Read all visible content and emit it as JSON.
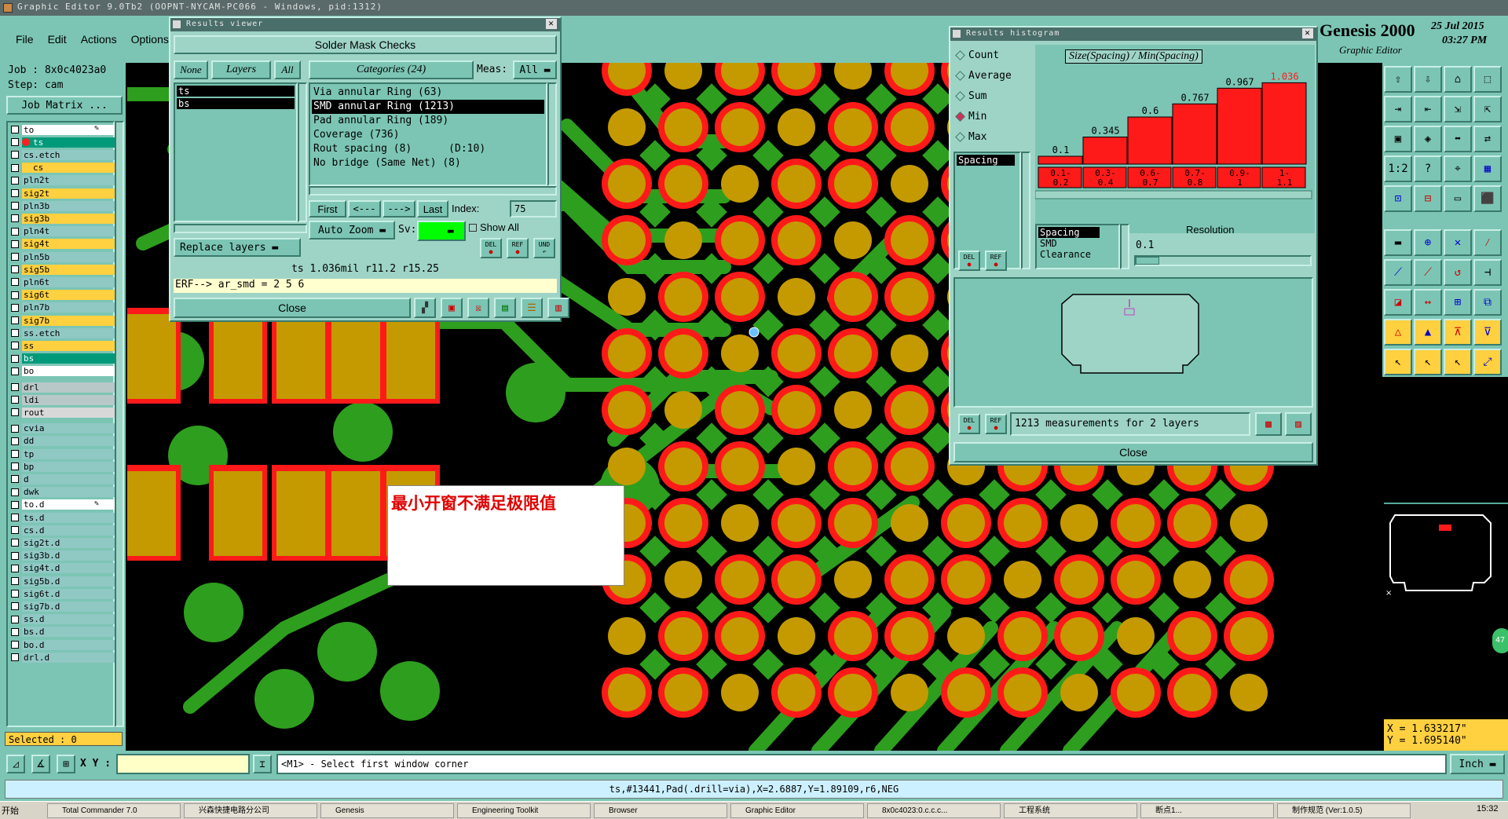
{
  "app": {
    "title_bar": "Graphic Editor 9.0Tb2 (OOPNT-NYCAM-PC066 - Windows, pid:1312)",
    "brand": "Genesis 2000",
    "brand_sub": "Graphic Editor",
    "date": "25 Jul 2015",
    "time": "03:27 PM"
  },
  "menu": [
    "File",
    "Edit",
    "Actions",
    "Options"
  ],
  "job": {
    "job": "Job : 8x0c4023a0",
    "step": "Step: cam",
    "matrix_button": "Job Matrix ..."
  },
  "layers": [
    {
      "name": "to",
      "color": "#ffffff",
      "text": "#000",
      "extra": "pen"
    },
    {
      "name": "ts",
      "color": "#009a7a",
      "text": "#fff",
      "dot": "#ff2020"
    },
    {
      "name": "cs.etch",
      "color": "#90c8c4",
      "text": "#000"
    },
    {
      "name": "cs",
      "color": "#ffd040",
      "text": "#000",
      "dot": "#ffd040"
    },
    {
      "name": "pln2t",
      "color": "#90c8c4",
      "text": "#000"
    },
    {
      "name": "sig2t",
      "color": "#ffd040",
      "text": "#000"
    },
    {
      "name": "pln3b",
      "color": "#90c8c4",
      "text": "#000"
    },
    {
      "name": "sig3b",
      "color": "#ffd040",
      "text": "#000"
    },
    {
      "name": "pln4t",
      "color": "#90c8c4",
      "text": "#000"
    },
    {
      "name": "sig4t",
      "color": "#ffd040",
      "text": "#000"
    },
    {
      "name": "pln5b",
      "color": "#90c8c4",
      "text": "#000"
    },
    {
      "name": "sig5b",
      "color": "#ffd040",
      "text": "#000"
    },
    {
      "name": "pln6t",
      "color": "#90c8c4",
      "text": "#000"
    },
    {
      "name": "sig6t",
      "color": "#ffd040",
      "text": "#000"
    },
    {
      "name": "pln7b",
      "color": "#90c8c4",
      "text": "#000"
    },
    {
      "name": "sig7b",
      "color": "#ffd040",
      "text": "#000"
    },
    {
      "name": "ss.etch",
      "color": "#90c8c4",
      "text": "#000"
    },
    {
      "name": "ss",
      "color": "#ffd040",
      "text": "#000"
    },
    {
      "name": "bs",
      "color": "#009a7a",
      "text": "#fff"
    },
    {
      "name": "bo",
      "color": "#ffffff",
      "text": "#000"
    },
    {
      "name": "drl",
      "color": "#b8c8c8",
      "text": "#000"
    },
    {
      "name": "ldi",
      "color": "#b8c8c8",
      "text": "#000"
    },
    {
      "name": "rout",
      "color": "#d8d8d8",
      "text": "#000"
    },
    {
      "name": "cvia",
      "color": "#90c8c4",
      "text": "#000"
    },
    {
      "name": "dd",
      "color": "#90c8c4",
      "text": "#000"
    },
    {
      "name": "tp",
      "color": "#90c8c4",
      "text": "#000"
    },
    {
      "name": "bp",
      "color": "#90c8c4",
      "text": "#000"
    },
    {
      "name": "d",
      "color": "#90c8c4",
      "text": "#000"
    },
    {
      "name": "dwk",
      "color": "#90c8c4",
      "text": "#000"
    },
    {
      "name": "to.d",
      "color": "#ffffff",
      "text": "#000",
      "extra": "pen"
    },
    {
      "name": "ts.d",
      "color": "#90c8c4",
      "text": "#000"
    },
    {
      "name": "cs.d",
      "color": "#90c8c4",
      "text": "#000"
    },
    {
      "name": "sig2t.d",
      "color": "#90c8c4",
      "text": "#000"
    },
    {
      "name": "sig3b.d",
      "color": "#90c8c4",
      "text": "#000"
    },
    {
      "name": "sig4t.d",
      "color": "#90c8c4",
      "text": "#000"
    },
    {
      "name": "sig5b.d",
      "color": "#90c8c4",
      "text": "#000"
    },
    {
      "name": "sig6t.d",
      "color": "#90c8c4",
      "text": "#000"
    },
    {
      "name": "sig7b.d",
      "color": "#90c8c4",
      "text": "#000"
    },
    {
      "name": "ss.d",
      "color": "#90c8c4",
      "text": "#000"
    },
    {
      "name": "bs.d",
      "color": "#90c8c4",
      "text": "#000"
    },
    {
      "name": "bo.d",
      "color": "#90c8c4",
      "text": "#000"
    },
    {
      "name": "drl.d",
      "color": "#90c8c4",
      "text": "#000"
    }
  ],
  "selected": "Selected : 0",
  "results_viewer": {
    "title": "Results viewer",
    "header": "Solder Mask Checks",
    "none": "None",
    "layers_label": "Layers",
    "all": "All",
    "layer_items": [
      "ts",
      "bs"
    ],
    "categories_label": "Categories (24)",
    "meas_label": "Meas:",
    "meas_value": "All",
    "categories": [
      {
        "text": "Via annular Ring (63)",
        "selected": false
      },
      {
        "text": "SMD annular Ring (1213)",
        "selected": true
      },
      {
        "text": "Pad annular Ring (189)",
        "selected": false
      },
      {
        "text": "Coverage (736)",
        "selected": false
      },
      {
        "text": "Rout spacing (8)      (D:10)",
        "selected": false
      },
      {
        "text": "No bridge (Same Net) (8)",
        "selected": false
      }
    ],
    "first": "First",
    "prev": "<---",
    "next": "--->",
    "last": "Last",
    "index_label": "Index:",
    "index_value": "75",
    "auto_zoom": "Auto Zoom",
    "sv_label": "Sv:",
    "show_all": "Show All",
    "replace_layers": "Replace layers",
    "del": "DEL",
    "ref": "REF",
    "und": "UND",
    "measurement": "ts 1.036mil   r11.2   r15.25",
    "erf": "ERF--> ar_smd = 2 5 6",
    "close": "Close"
  },
  "annotation": "最小开窗不满足极限值",
  "histogram": {
    "title": "Results histogram",
    "radio": [
      {
        "label": "Count",
        "checked": false
      },
      {
        "label": "Average",
        "checked": false
      },
      {
        "label": "Sum",
        "checked": false
      },
      {
        "label": "Min",
        "checked": true
      },
      {
        "label": "Max",
        "checked": false
      }
    ],
    "list_item": "Spacing",
    "chart_title": "Size(Spacing) / Min(Spacing)",
    "resolution_list": [
      "Spacing",
      "SMD",
      "Clearance"
    ],
    "resolution_label": "Resolution",
    "resolution_value": "0.1",
    "measurements": "1213 measurements for 2 layers",
    "close": "Close",
    "del": "DEL",
    "ref": "REF"
  },
  "chart_data": {
    "type": "bar",
    "title": "Size(Spacing) / Min(Spacing)",
    "categories": [
      "0.1-0.2",
      "0.3-0.4",
      "0.6-0.7",
      "0.7-0.8",
      "0.9-1",
      "1-1.1"
    ],
    "values": [
      0.1,
      0.345,
      0.6,
      0.767,
      0.967,
      1.036
    ],
    "value_labels": [
      "0.1",
      "0.345",
      "0.6",
      "0.767",
      "0.967",
      "1.036"
    ],
    "bar_color": "#ff1a1a",
    "ylim": [
      0,
      1.1
    ]
  },
  "command": {
    "xy_label": "X Y :",
    "xy_value": "",
    "prompt": "<M1> - Select first window corner",
    "units": "Inch"
  },
  "coords": {
    "x": "X = 1.633217\"",
    "y": "Y = 1.695140\""
  },
  "status_line": "ts,#13441,Pad(.drill=via),X=2.6887,Y=1.89109,r6,NEG",
  "taskbar": {
    "start": "开始",
    "items": [
      "Total Commander 7.0",
      "兴森快捷电路分公司",
      "Genesis",
      "Engineering Toolkit",
      "Browser",
      "Graphic Editor",
      "8x0c4023:0.c.c.c...",
      "工程系统",
      "断点1...",
      "制作规范 (Ver:1.0.5)"
    ],
    "clock": "15:32"
  },
  "side_badge": "47"
}
